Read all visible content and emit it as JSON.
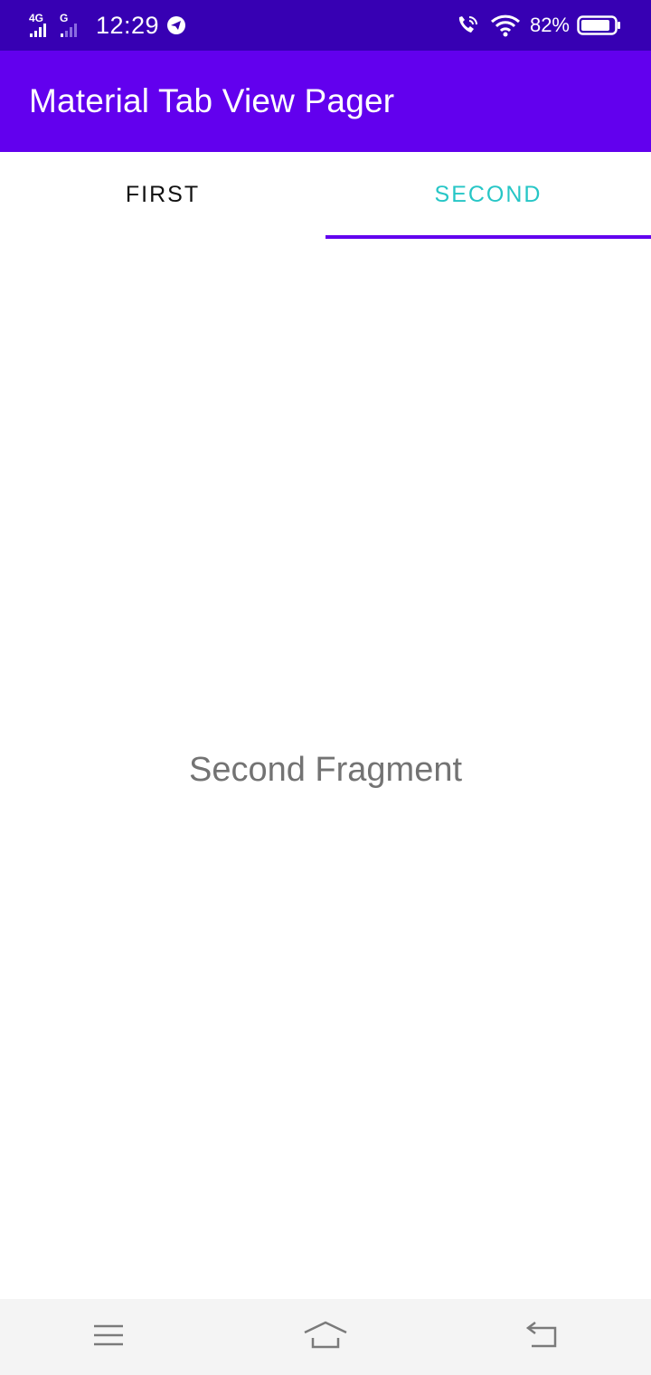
{
  "status_bar": {
    "network_label": "4G",
    "secondary_network_label": "G",
    "time": "12:29",
    "battery_percent": "82%"
  },
  "app_bar": {
    "title": "Material Tab View Pager"
  },
  "tabs": [
    {
      "label": "FIRST",
      "selected": false
    },
    {
      "label": "SECOND",
      "selected": true
    }
  ],
  "content": {
    "fragment_text": "Second Fragment"
  },
  "nav_bar": {
    "buttons": [
      "menu-icon",
      "home-icon",
      "back-icon"
    ]
  },
  "colors": {
    "status_bar": "#3700b3",
    "app_bar": "#6200ee",
    "tab_indicator": "#6200ee",
    "active_tab_text": "#26c6c6",
    "inactive_tab_text": "#111111",
    "fragment_text": "#737373",
    "nav_bar": "#f4f4f4"
  }
}
